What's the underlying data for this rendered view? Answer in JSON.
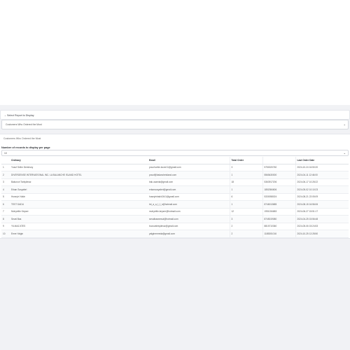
{
  "report_section": {
    "header_label": "Select Report to Display",
    "selected_report": "Customers Who Ordered the Most"
  },
  "report": {
    "title": "Customers Who Ordered the Most",
    "records_label": "Number of records to display per page",
    "records_value": "10"
  },
  "table": {
    "headers": [
      "",
      "Ordinary",
      "Email",
      "Total Order",
      "",
      "Last Order Date"
    ],
    "rows": [
      {
        "idx": "1",
        "name": "Yusuf Selim Demirsoy",
        "email": "yusuf.selim.kocer11@gmail.com",
        "total": "3",
        "phone": "5750020760",
        "date": "2024-10-24 16:50:20"
      },
      {
        "idx": "2",
        "name": "DIVERGENSE INTERNATIONAL INC. LA BALANCHE ISLAND HOTEL",
        "email": "yusuf@balancheisland.com",
        "total": "1",
        "phone": "5565430000",
        "date": "2024-04-11 12:46:00"
      },
      {
        "idx": "3",
        "name": "Bakunuri Tarkyilmaz",
        "email": "bak.usamia@gmail.com",
        "total": "18",
        "phone": "5363917206",
        "date": "2024-06-17 10:28:22"
      },
      {
        "idx": "4",
        "name": "Erkan Sosyaleri",
        "email": "erkansosyaleri@gmail.com",
        "total": "1",
        "phone": "1852084606",
        "date": "2024-05-02 10:10:23"
      },
      {
        "idx": "5",
        "name": "Huseyin Yakin",
        "email": "huseyinbakir2441@gmail.com",
        "total": "6",
        "phone": "5330058024",
        "date": "2024-08-21 22:05:09"
      },
      {
        "idx": "6",
        "name": "TEST DADU",
        "email": "tnt_a_a_t_t_n@hotmail.com",
        "total": "1",
        "phone": "8746013685",
        "date": "2024-08-15 16:56:06"
      },
      {
        "idx": "7",
        "name": "Muhyettin Keyser",
        "email": "muhyettin.keyser@hotmail.com",
        "total": "12",
        "phone": "1951034683",
        "date": "2024-06-27 15:51:17"
      },
      {
        "idx": "8",
        "name": "Seval Bas",
        "email": "sevalbasmesut@hotmail.com",
        "total": "3",
        "phone": "8745019080",
        "date": "2024-04-25 15:56:48"
      },
      {
        "idx": "9",
        "name": "YILMAZ ATES",
        "email": "bozovatesyilmaz@gmail.com",
        "total": "2",
        "phone": "8815710360",
        "date": "2024-05-06 15:24:53"
      },
      {
        "idx": "10",
        "name": "Emre Yalgin",
        "email": "yalginemreda@gmail.com",
        "total": "2",
        "phone": "1185301016",
        "date": "2024-10-25 12:28:50"
      }
    ]
  }
}
